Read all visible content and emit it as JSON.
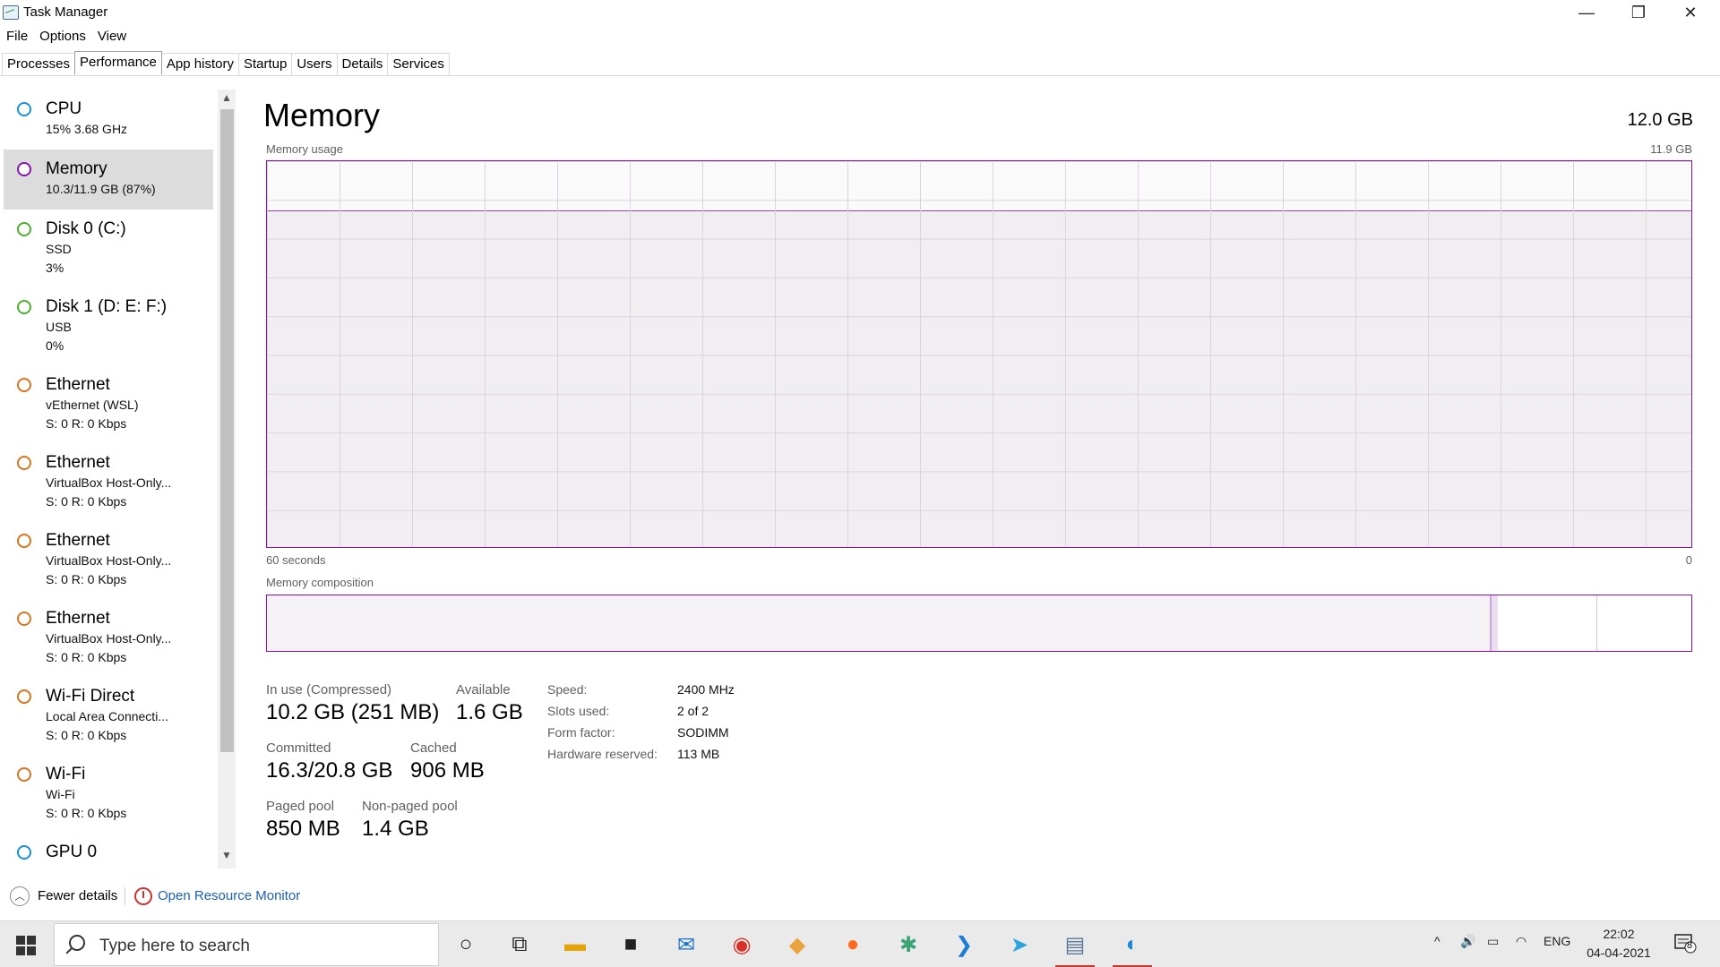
{
  "window": {
    "title": "Task Manager",
    "minimize": "—",
    "maximize": "❐",
    "close": "✕"
  },
  "menu": [
    "File",
    "Options",
    "View"
  ],
  "tabs": [
    {
      "label": "Processes",
      "active": false
    },
    {
      "label": "Performance",
      "active": true
    },
    {
      "label": "App history",
      "active": false
    },
    {
      "label": "Startup",
      "active": false
    },
    {
      "label": "Users",
      "active": false
    },
    {
      "label": "Details",
      "active": false
    },
    {
      "label": "Services",
      "active": false
    }
  ],
  "sidebar": [
    {
      "name": "CPU",
      "sub1": "15%  3.68 GHz",
      "sub2": "",
      "color": "#1a8fd8",
      "selected": false
    },
    {
      "name": "Memory",
      "sub1": "10.3/11.9 GB (87%)",
      "sub2": "",
      "color": "#8b12ae",
      "selected": true
    },
    {
      "name": "Disk 0 (C:)",
      "sub1": "SSD",
      "sub2": "3%",
      "color": "#4daf2e",
      "selected": false
    },
    {
      "name": "Disk 1 (D: E: F:)",
      "sub1": "USB",
      "sub2": "0%",
      "color": "#4daf2e",
      "selected": false
    },
    {
      "name": "Ethernet",
      "sub1": "vEthernet (WSL)",
      "sub2": "S: 0  R: 0 Kbps",
      "color": "#d87520",
      "selected": false
    },
    {
      "name": "Ethernet",
      "sub1": "VirtualBox Host-Only...",
      "sub2": "S: 0  R: 0 Kbps",
      "color": "#d87520",
      "selected": false
    },
    {
      "name": "Ethernet",
      "sub1": "VirtualBox Host-Only...",
      "sub2": "S: 0  R: 0 Kbps",
      "color": "#d87520",
      "selected": false
    },
    {
      "name": "Ethernet",
      "sub1": "VirtualBox Host-Only...",
      "sub2": "S: 0  R: 0 Kbps",
      "color": "#d87520",
      "selected": false
    },
    {
      "name": "Wi-Fi Direct",
      "sub1": "Local Area Connecti...",
      "sub2": "S: 0  R: 0 Kbps",
      "color": "#d87520",
      "selected": false
    },
    {
      "name": "Wi-Fi",
      "sub1": "Wi-Fi",
      "sub2": "S: 0  R: 0 Kbps",
      "color": "#d87520",
      "selected": false
    },
    {
      "name": "GPU 0",
      "sub1": "",
      "sub2": "",
      "color": "#1a8fd8",
      "selected": false
    }
  ],
  "main": {
    "title": "Memory",
    "total": "12.0 GB",
    "usage_label": "Memory usage",
    "usage_max": "11.9 GB",
    "time_left": "60 seconds",
    "time_right": "0",
    "composition_label": "Memory composition",
    "usage_fraction": 0.87,
    "composition": {
      "in_use_fraction": 0.86,
      "modified_fraction": 0.004,
      "standby_fraction": 0.07
    }
  },
  "stats": {
    "in_use_label": "In use (Compressed)",
    "in_use_value": "10.2 GB (251 MB)",
    "available_label": "Available",
    "available_value": "1.6 GB",
    "committed_label": "Committed",
    "committed_value": "16.3/20.8 GB",
    "cached_label": "Cached",
    "cached_value": "906 MB",
    "paged_label": "Paged pool",
    "paged_value": "850 MB",
    "nonpaged_label": "Non-paged pool",
    "nonpaged_value": "1.4 GB"
  },
  "specs": [
    {
      "label": "Speed:",
      "value": "2400 MHz"
    },
    {
      "label": "Slots used:",
      "value": "2 of 2"
    },
    {
      "label": "Form factor:",
      "value": "SODIMM"
    },
    {
      "label": "Hardware reserved:",
      "value": "113 MB"
    }
  ],
  "footer": {
    "fewer_details": "Fewer details",
    "resource_monitor": "Open Resource Monitor"
  },
  "taskbar": {
    "search_placeholder": "Type here to search",
    "apps": [
      {
        "name": "cortana-icon",
        "glyph": "○",
        "color": "#222"
      },
      {
        "name": "task-view-icon",
        "glyph": "⧉",
        "color": "#222"
      },
      {
        "name": "file-explorer-icon",
        "glyph": "▬",
        "color": "#e5a50a"
      },
      {
        "name": "store-icon",
        "glyph": "■",
        "color": "#222"
      },
      {
        "name": "mail-icon",
        "glyph": "✉",
        "color": "#1a73c7"
      },
      {
        "name": "chrome-icon",
        "glyph": "◉",
        "color": "#d93025"
      },
      {
        "name": "git-kraken-icon",
        "glyph": "◆",
        "color": "#e8a33c"
      },
      {
        "name": "firefox-icon",
        "glyph": "●",
        "color": "#ff6a1a"
      },
      {
        "name": "slack-icon",
        "glyph": "✱",
        "color": "#3aa374"
      },
      {
        "name": "vscode-icon",
        "glyph": "❯",
        "color": "#1a7fd4"
      },
      {
        "name": "telegram-icon",
        "glyph": "➤",
        "color": "#2aa3df"
      },
      {
        "name": "task-manager-icon",
        "glyph": "▤",
        "color": "#5b7a99"
      },
      {
        "name": "edge-icon",
        "glyph": "◐",
        "color": "#1a88d6"
      }
    ],
    "tray": {
      "chevron": "^",
      "volume": "🔊",
      "battery": "▭",
      "wifi": "◠",
      "language": "ENG"
    },
    "time": "22:02",
    "date": "04-04-2021",
    "notification_count": "8"
  }
}
